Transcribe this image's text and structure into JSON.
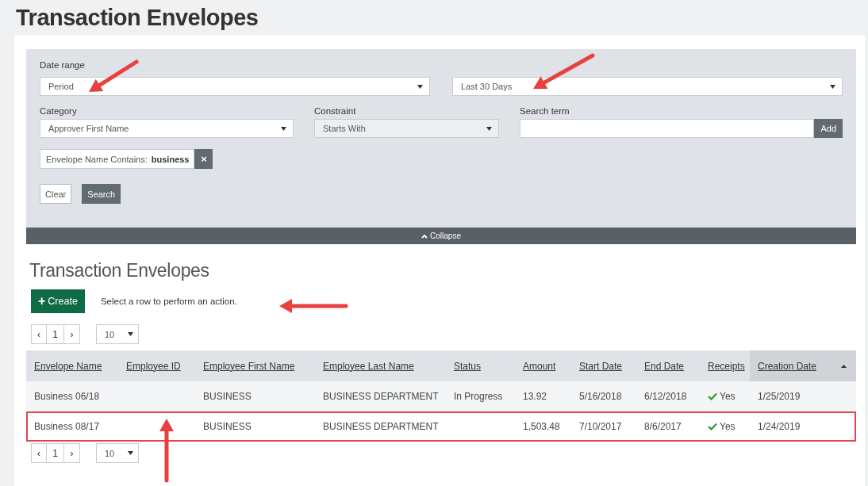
{
  "page_title": "Transaction Envelopes",
  "filters": {
    "date_range": {
      "label": "Date range",
      "period": "Period",
      "range": "Last 30 Days"
    },
    "category": {
      "label": "Category",
      "value": "Approver First Name"
    },
    "constraint": {
      "label": "Constraint",
      "value": "Starts With",
      "disabled": true
    },
    "search_term": {
      "label": "Search term",
      "add_button": "Add"
    },
    "chips": [
      {
        "label": "Envelope Name Contains:",
        "value": "business",
        "remove": "×"
      }
    ],
    "clear_button": "Clear",
    "search_button": "Search",
    "collapse": "Collapse"
  },
  "section_title": "Transaction Envelopes",
  "create_button": {
    "icon": "+",
    "label": "Create"
  },
  "hint": "Select a row to perform an action.",
  "pager_top": {
    "prev": "‹",
    "page": "1",
    "next": "›",
    "page_size": "10"
  },
  "table": {
    "columns": [
      {
        "label": "Envelope Name",
        "kind": "text",
        "sorted": false
      },
      {
        "label": "Employee ID",
        "kind": "text",
        "sorted": false
      },
      {
        "label": "Employee First Name",
        "kind": "text",
        "sorted": false
      },
      {
        "label": "Employee Last Name",
        "kind": "text",
        "sorted": false
      },
      {
        "label": "Status",
        "kind": "text",
        "sorted": false
      },
      {
        "label": "Amount",
        "kind": "text",
        "sorted": false
      },
      {
        "label": "Start Date",
        "kind": "text",
        "sorted": false
      },
      {
        "label": "End Date",
        "kind": "text",
        "sorted": false
      },
      {
        "label": "Receipts",
        "kind": "check",
        "sorted": false
      },
      {
        "label": "Creation Date",
        "kind": "text",
        "sorted": true
      }
    ],
    "rows": [
      {
        "highlighted": false,
        "cells": [
          "Business 06/18",
          "",
          "BUSINESS",
          "BUSINESS DEPARTMENT",
          "In Progress",
          "13.92",
          "5/16/2018",
          "6/12/2018",
          "Yes",
          "1/25/2019"
        ]
      },
      {
        "highlighted": true,
        "cells": [
          "Business 08/17",
          "",
          "BUSINESS",
          "BUSINESS DEPARTMENT",
          "",
          "1,503.48",
          "7/10/2017",
          "8/6/2017",
          "Yes",
          "1/24/2019"
        ]
      }
    ]
  },
  "pager_bottom": {
    "prev": "‹",
    "page": "1",
    "next": "›",
    "page_size": "10"
  }
}
